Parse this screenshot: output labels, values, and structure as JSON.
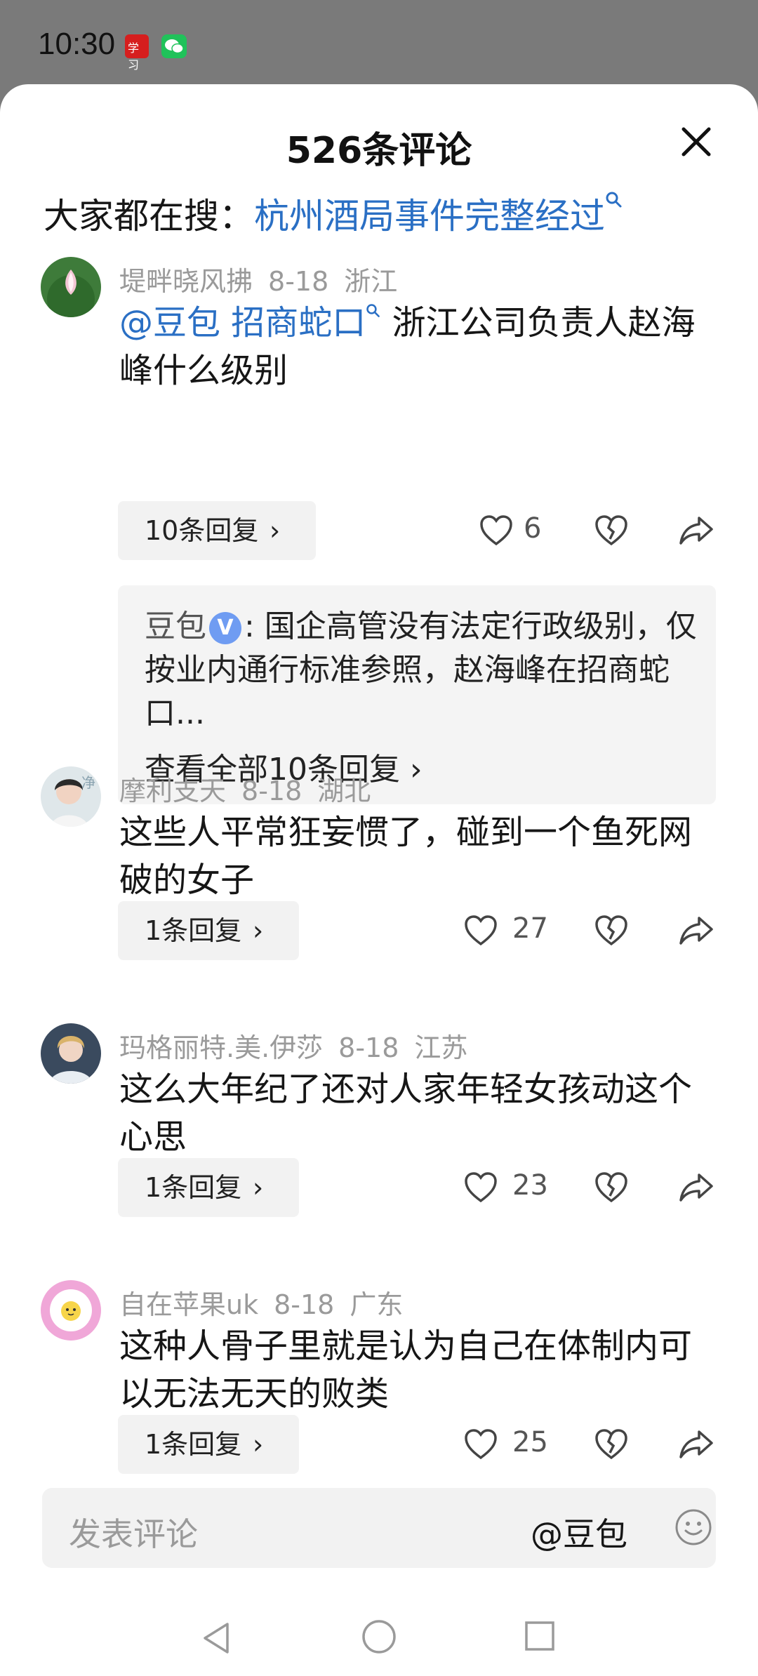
{
  "status_bar": {
    "time": "10:30",
    "icon1": "xuexi-app-icon",
    "icon2": "wechat-icon"
  },
  "header": {
    "title": "526条评论",
    "close_icon": "close-icon"
  },
  "search": {
    "label": "大家都在搜：",
    "keyword": "杭州酒局事件完整经过"
  },
  "comments": [
    {
      "user": "堤畔晓风拂",
      "date": "8-18",
      "region": "浙江",
      "mention": "@豆包",
      "keyword": "招商蛇口",
      "text_after": "浙江公司负责人赵海峰什么级别",
      "replies_label": "10条回复",
      "likes": "6",
      "ai_reply": {
        "name": "豆包",
        "badge": "V",
        "text": ": 国企高管没有法定行政级别，仅按业内通行标准参照，赵海峰在招商蛇口...",
        "more": "查看全部10条回复"
      }
    },
    {
      "user": "摩利支天",
      "date": "8-18",
      "region": "湖北",
      "text": "这些人平常狂妄惯了，碰到一个鱼死网破的女子",
      "replies_label": "1条回复",
      "likes": "27"
    },
    {
      "user": "玛格丽特.美.伊莎",
      "date": "8-18",
      "region": "江苏",
      "text": "这么大年纪了还对人家年轻女孩动这个心思",
      "replies_label": "1条回复",
      "likes": "23"
    },
    {
      "user": "自在苹果uk",
      "date": "8-18",
      "region": "广东",
      "text": "这种人骨子里就是认为自己在体制内可以无法无天的败类",
      "replies_label": "1条回复",
      "likes": "25"
    }
  ],
  "input": {
    "placeholder": "发表评论",
    "at_label": "@豆包"
  },
  "colors": {
    "link": "#2a6fc4",
    "meta": "#9a9a9a",
    "chip_bg": "#f2f2f2",
    "badge": "#6f9cf2"
  }
}
